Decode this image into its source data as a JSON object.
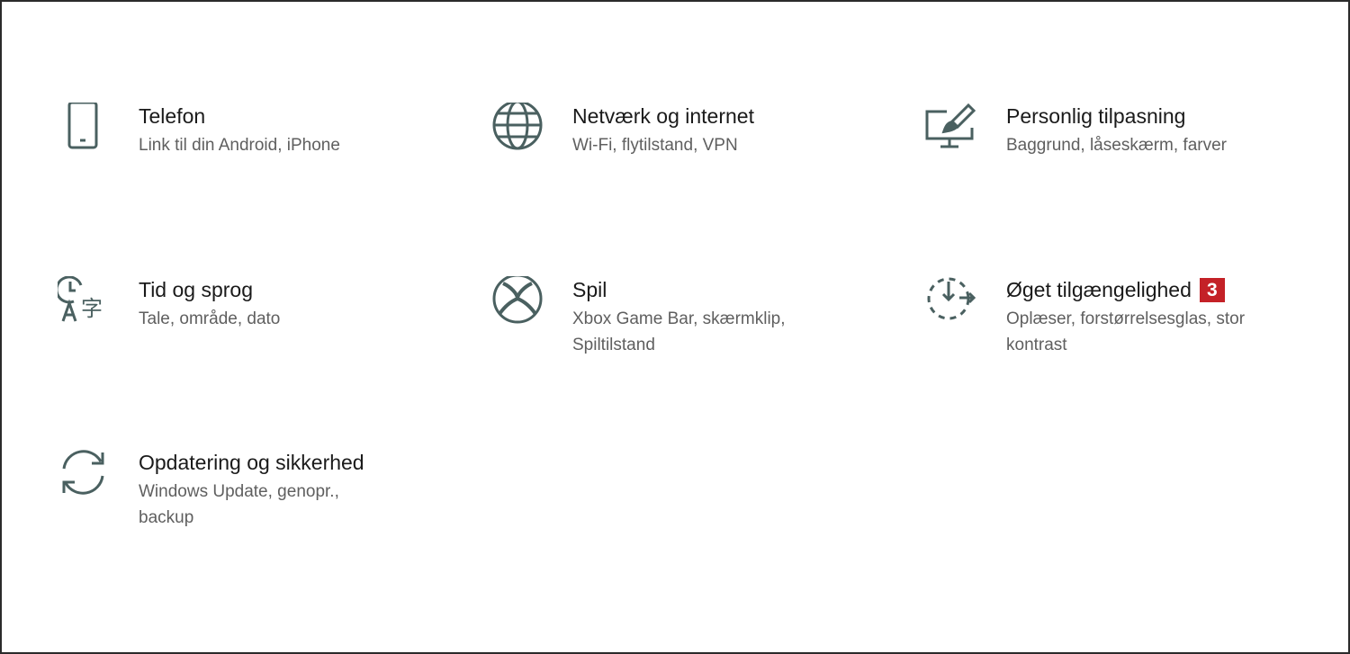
{
  "settings": {
    "items": [
      {
        "title": "Telefon",
        "subtitle": "Link til din Android, iPhone",
        "icon": "phone-icon"
      },
      {
        "title": "Netværk og internet",
        "subtitle": "Wi-Fi, flytilstand, VPN",
        "icon": "globe-icon"
      },
      {
        "title": "Personlig tilpasning",
        "subtitle": "Baggrund, låseskærm, farver",
        "icon": "personalization-icon"
      },
      {
        "title": "Tid og sprog",
        "subtitle": "Tale, område, dato",
        "icon": "time-language-icon"
      },
      {
        "title": "Spil",
        "subtitle": "Xbox Game Bar, skærmklip, Spiltilstand",
        "icon": "xbox-icon"
      },
      {
        "title": "Øget tilgængelighed",
        "subtitle": "Oplæser, forstørrelsesglas, stor kontrast",
        "icon": "ease-of-access-icon",
        "badge": "3"
      },
      {
        "title": "Opdatering og sikkerhed",
        "subtitle": "Windows Update, genopr., backup",
        "icon": "update-sync-icon"
      }
    ]
  },
  "colors": {
    "icon": "#4a6060",
    "badge": "#c42127",
    "title": "#1a1a1a",
    "subtitle": "#5f5f5f"
  }
}
